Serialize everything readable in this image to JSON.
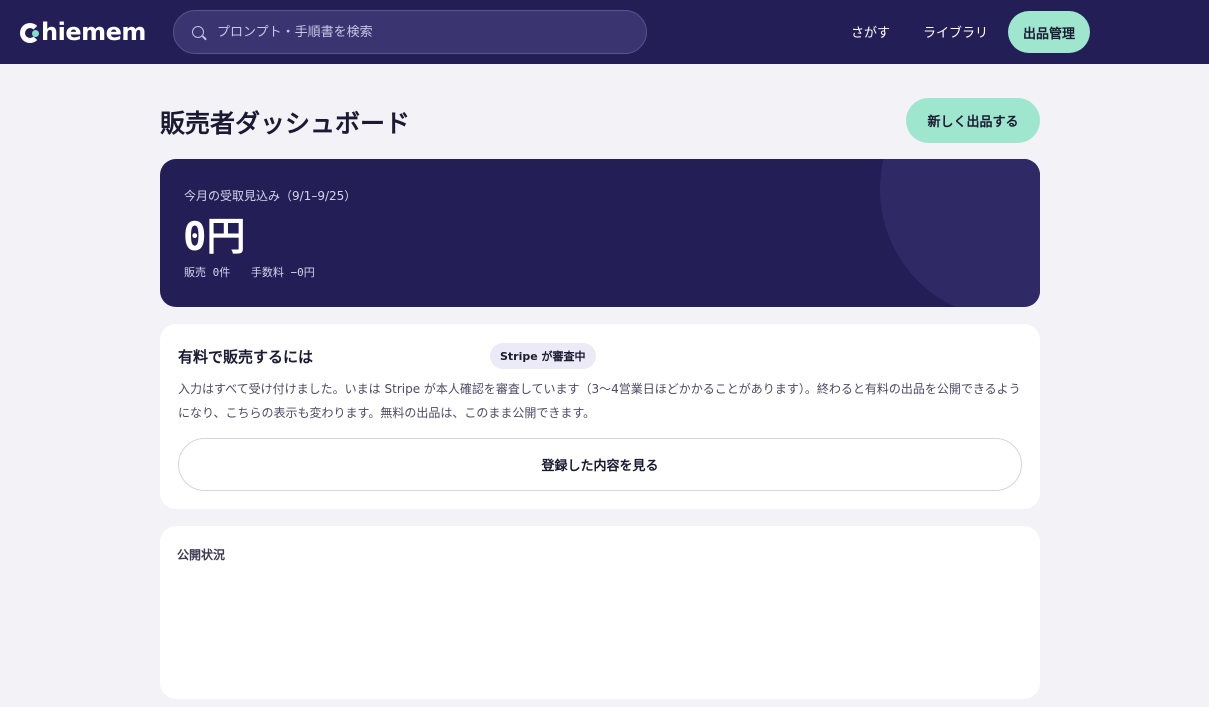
{
  "header": {
    "logo_text": "hiemem",
    "search_placeholder": "プロンプト・手順書を検索",
    "nav": {
      "search_link": "さがす",
      "library_link": "ライブラリ",
      "manage_link": "出品管理"
    }
  },
  "page": {
    "title": "販売者ダッシュボード",
    "new_listing_button": "新しく出品する"
  },
  "revenue": {
    "label": "今月の受取見込み（9/1–9/25）",
    "amount": "0円",
    "sales": "販売 0件",
    "fee": "手数料 −0円"
  },
  "stripe_card": {
    "title": "有料で販売するには",
    "badge": "Stripe が審査中",
    "description": "入力はすべて受け付けました。いまは Stripe が本人確認を審査しています（3〜4営業日ほどかかることがあります）。終わると有料の出品を公開できるようになり、こちらの表示も変わります。無料の出品は、このまま公開できます。",
    "view_button": "登録した内容を見る"
  },
  "status_card": {
    "title": "公開状況"
  },
  "colors": {
    "header_bg": "#241e57",
    "accent_mint": "#9ee6ce",
    "page_bg": "#f3f2f7"
  }
}
